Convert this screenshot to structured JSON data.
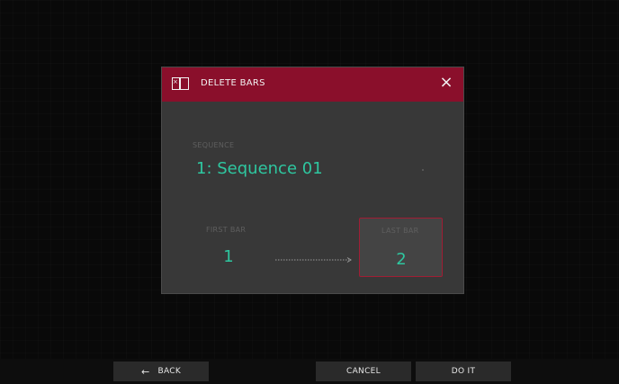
{
  "dialog": {
    "title": "DELETE BARS",
    "icon": "delete-bars-icon",
    "close_icon": "close-icon",
    "sequence": {
      "label": "SEQUENCE",
      "value": "1: Sequence 01"
    },
    "first_bar": {
      "label": "FIRST BAR",
      "value": "1"
    },
    "last_bar": {
      "label": "LAST BAR",
      "value": "2"
    },
    "arrow_icon": "dotted-arrow-right-icon"
  },
  "bottom_bar": {
    "back_label": "BACK",
    "back_icon": "arrow-left-icon",
    "cancel_label": "CANCEL",
    "doit_label": "DO IT"
  },
  "colors": {
    "header": "#8a0f2b",
    "accent_value": "#2ec7a0",
    "selected_border": "#a01d34",
    "dialog_bg": "#383838"
  }
}
